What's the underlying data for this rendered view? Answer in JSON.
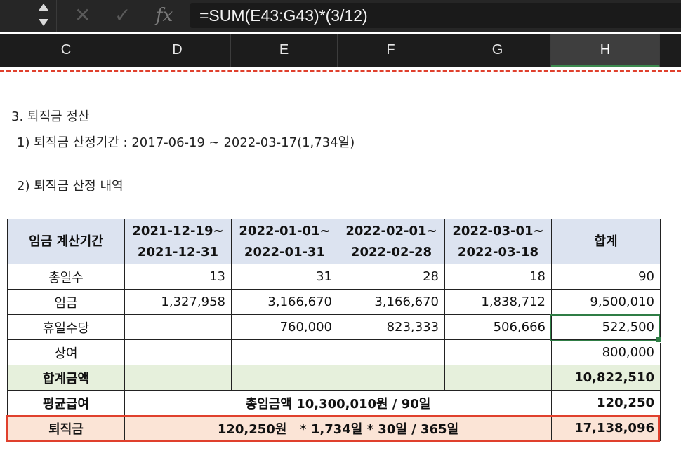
{
  "formula_bar": {
    "formula": "=SUM(E43:G43)*(3/12)",
    "fx_label": "fx",
    "cancel_glyph": "✕",
    "confirm_glyph": "✓"
  },
  "columns": [
    "C",
    "D",
    "E",
    "F",
    "G",
    "H"
  ],
  "selected_column": "H",
  "doc": {
    "section_title": "3. 퇴직금 정산",
    "period_line": "1) 퇴직금 산정기간 : 2017-06-19  ~  2022-03-17(1,734일)",
    "detail_title": "2) 퇴직금 산정 내역"
  },
  "table": {
    "headers": {
      "period": "임금 계산기간",
      "col1_line1": "2021-12-19~",
      "col1_line2": "2021-12-31",
      "col2_line1": "2022-01-01~",
      "col2_line2": "2022-01-31",
      "col3_line1": "2022-02-01~",
      "col3_line2": "2022-02-28",
      "col4_line1": "2022-03-01~",
      "col4_line2": "2022-03-18",
      "total": "합계"
    },
    "rows": {
      "days": {
        "label": "총일수",
        "v1": "13",
        "v2": "31",
        "v3": "28",
        "v4": "18",
        "total": "90"
      },
      "wage": {
        "label": "임금",
        "v1": "1,327,958",
        "v2": "3,166,670",
        "v3": "3,166,670",
        "v4": "1,838,712",
        "total": "9,500,010"
      },
      "holiday": {
        "label": "휴일수당",
        "v1": "",
        "v2": "760,000",
        "v3": "823,333",
        "v4": "506,666",
        "total": "522,500"
      },
      "bonus": {
        "label": "상여",
        "v1": "",
        "v2": "",
        "v3": "",
        "v4": "",
        "total": "800,000"
      },
      "sum": {
        "label": "합계금액",
        "total": "10,822,510"
      },
      "avg": {
        "label": "평균급여",
        "formula_text": "총임금액 10,300,010원 / 90일",
        "total": "120,250"
      },
      "severance": {
        "label": "퇴직금",
        "formula_text": "120,250원   * 1,734일 * 30일 / 365일",
        "total": "17,138,096"
      }
    }
  },
  "colors": {
    "header_fill": "#dce3f0",
    "sum_row_fill": "#e6f0dc",
    "severance_row_fill": "#fbe4d6",
    "highlight_border": "#e0402d",
    "selection_border": "#2f7d45"
  }
}
